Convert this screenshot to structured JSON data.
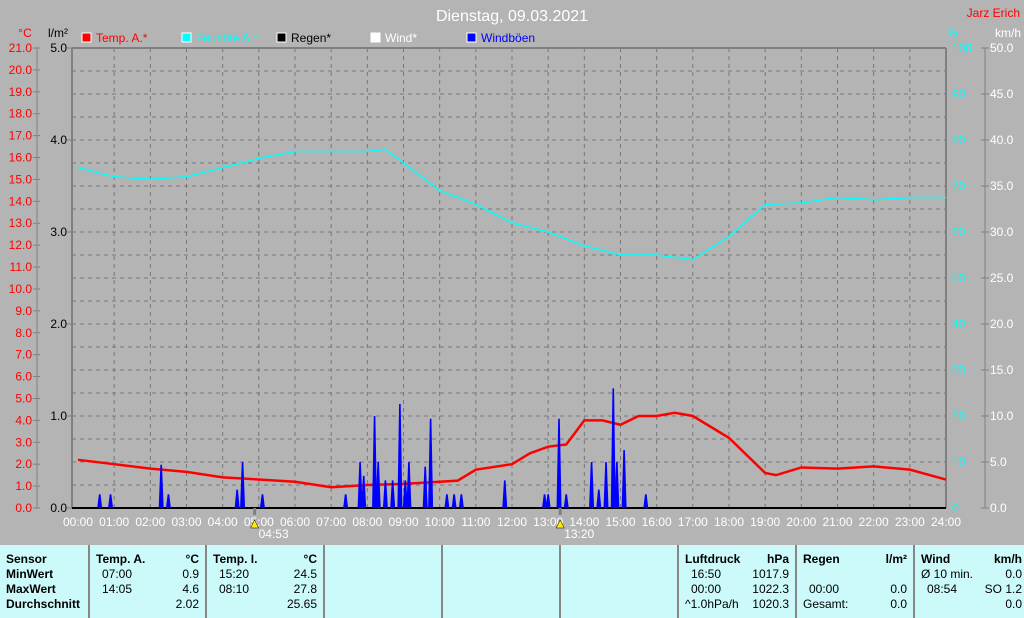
{
  "chart_data": {
    "type": "line",
    "title": "Dienstag, 09.03.2021",
    "author": "Jarz Erich",
    "x_unit": "hour",
    "xlim": [
      0,
      24
    ],
    "x_ticks": [
      "00:00",
      "01:00",
      "02:00",
      "03:00",
      "04:00",
      "05:00",
      "06:00",
      "07:00",
      "08:00",
      "09:00",
      "10:00",
      "11:00",
      "12:00",
      "13:00",
      "14:00",
      "15:00",
      "16:00",
      "17:00",
      "18:00",
      "19:00",
      "20:00",
      "21:00",
      "22:00",
      "23:00",
      "24:00"
    ],
    "axes": {
      "temp": {
        "label": "°C",
        "range": [
          0,
          21
        ],
        "ticks": [
          "21.0",
          "20.0",
          "19.0",
          "18.0",
          "17.0",
          "16.0",
          "15.0",
          "14.0",
          "13.0",
          "12.0",
          "11.0",
          "10.0",
          "9.0",
          "8.0",
          "7.0",
          "6.0",
          "5.0",
          "4.0",
          "3.0",
          "2.0",
          "1.0",
          "0.0"
        ]
      },
      "rain": {
        "label": "l/m²",
        "range": [
          0,
          5
        ],
        "ticks": [
          "5.0",
          "4.0",
          "3.0",
          "2.0",
          "1.0",
          "0.0"
        ]
      },
      "humidity": {
        "label": "%",
        "range": [
          0,
          100
        ],
        "ticks": [
          "100",
          "90",
          "80",
          "70",
          "60",
          "50",
          "40",
          "30",
          "20",
          "10",
          "0"
        ]
      },
      "wind": {
        "label": "km/h",
        "range": [
          0,
          50
        ],
        "ticks": [
          "50.0",
          "45.0",
          "40.0",
          "35.0",
          "30.0",
          "25.0",
          "20.0",
          "15.0",
          "10.0",
          "5.0",
          "0.0"
        ]
      }
    },
    "legend": [
      {
        "name": "Temp. A.*",
        "color": "#ff0000"
      },
      {
        "name": "Feuchte A.*",
        "color": "#00ffff"
      },
      {
        "name": "Regen*",
        "color": "#000000"
      },
      {
        "name": "Wind*",
        "color": "#ffffff"
      },
      {
        "name": "Windböen",
        "color": "#0000ff"
      }
    ],
    "series": [
      {
        "name": "Temp. A.*",
        "axis": "temp",
        "color": "#ff0000",
        "x": [
          0,
          1,
          2,
          3,
          4,
          5,
          6,
          7,
          8,
          9,
          10,
          10.5,
          11,
          12,
          12.5,
          13,
          13.5,
          14,
          14.5,
          15,
          15.5,
          16,
          16.5,
          17,
          18,
          19,
          19.3,
          20,
          21,
          22,
          23,
          24
        ],
        "y": [
          2.2,
          2.0,
          1.8,
          1.65,
          1.4,
          1.3,
          1.2,
          0.95,
          1.05,
          1.1,
          1.2,
          1.25,
          1.75,
          2.0,
          2.5,
          2.8,
          2.9,
          4.0,
          4.0,
          3.8,
          4.2,
          4.2,
          4.35,
          4.2,
          3.2,
          1.6,
          1.5,
          1.85,
          1.8,
          1.9,
          1.75,
          1.3
        ]
      },
      {
        "name": "Feuchte A.*",
        "axis": "humidity",
        "color": "#00ffff",
        "x": [
          0,
          1,
          2,
          3,
          4,
          5,
          6,
          7,
          8,
          8.5,
          9,
          10,
          11,
          12,
          13,
          14,
          15,
          16,
          17,
          18,
          19,
          20,
          21,
          22,
          23,
          24
        ],
        "y": [
          74,
          72,
          71.5,
          72,
          74,
          76,
          77.5,
          77.5,
          77.5,
          78,
          75,
          69,
          66,
          62,
          60,
          57,
          55,
          55,
          54,
          59,
          66,
          66.3,
          67.5,
          67,
          67.5,
          67.5
        ]
      },
      {
        "name": "Windböen",
        "axis": "wind",
        "color": "#0000ff",
        "style": "spikes",
        "x": [
          0.6,
          0.9,
          2.3,
          2.5,
          4.4,
          4.55,
          5.1,
          7.4,
          7.8,
          7.9,
          8.2,
          8.3,
          8.5,
          8.7,
          8.9,
          9.05,
          9.15,
          9.6,
          9.75,
          10.2,
          10.4,
          10.6,
          11.8,
          12.9,
          13.0,
          13.3,
          13.5,
          14.2,
          14.4,
          14.6,
          14.8,
          14.9,
          15.1,
          15.7
        ],
        "y": [
          1.5,
          1.5,
          4.7,
          1.5,
          2,
          5,
          1.5,
          1.5,
          5,
          3.5,
          10,
          5,
          3,
          3,
          11.3,
          3,
          5,
          4.5,
          9.7,
          1.5,
          1.5,
          1.5,
          3,
          1.5,
          1.5,
          9.7,
          1.5,
          5,
          2,
          5,
          13,
          5,
          6.3,
          1.5
        ]
      }
    ],
    "annotations": [
      {
        "x": 4.883,
        "label": "04:53",
        "icon": "sunrise-icon"
      },
      {
        "x": 13.333,
        "label": "13:20",
        "icon": "sunset-icon"
      }
    ],
    "grid": true
  },
  "table": {
    "sensor": {
      "h": "Sensor",
      "min": "MinWert",
      "max": "MaxWert",
      "avg": "Durchschnitt"
    },
    "temp_a": {
      "h": "Temp. A.",
      "unit": "°C",
      "min_t": "07:00",
      "min_v": "0.9",
      "max_t": "14:05",
      "max_v": "4.6",
      "avg": "2.02"
    },
    "temp_i": {
      "h": "Temp. I.",
      "unit": "°C",
      "min_t": "15:20",
      "min_v": "24.5",
      "max_t": "08:10",
      "max_v": "27.8",
      "avg": "25.65"
    },
    "pressure": {
      "h": "Luftdruck",
      "unit": "hPa",
      "min_t": "16:50",
      "min_v": "1017.9",
      "max_t": "00:00",
      "max_v": "1022.3",
      "avg_t": "^1.0hPa/h",
      "avg": "1020.3"
    },
    "rain": {
      "h": "Regen",
      "unit": "l/m²",
      "max_t": "00:00",
      "max_v": "0.0",
      "avg_t": "Gesamt:",
      "avg": "0.0"
    },
    "wind": {
      "h": "Wind",
      "unit": "km/h",
      "min_t": "Ø 10 min.",
      "min_v": "0.0",
      "max_t": "08:54",
      "max_v": "SO 1.2",
      "avg": "0.0"
    }
  }
}
